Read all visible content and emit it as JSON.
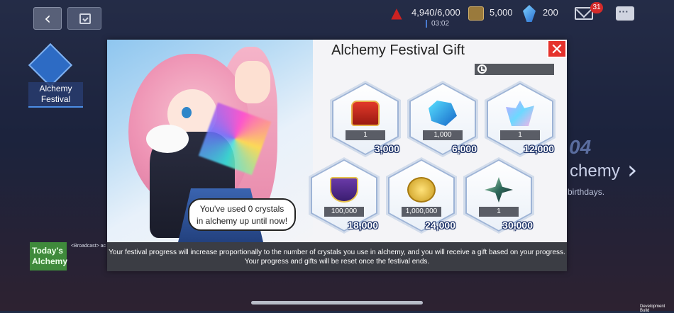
{
  "topbar": {
    "back_icon": "back-arrow-icon",
    "calendar_icon": "calendar-check-icon",
    "stamina": "4,940/6,000",
    "stamina_timer": "03:02",
    "gold": "5,000",
    "crystals": "200",
    "mail_badge": "31"
  },
  "left_panel": {
    "event_label_line1": "Alchemy",
    "event_label_line2": "Festival",
    "today_line1": "Today's",
    "today_line2": "Alchemy",
    "broadcast_text": "<Broadcast> ac"
  },
  "background": {
    "number": "04",
    "alchemy": "chemy",
    "birthdays": "birthdays."
  },
  "popup": {
    "title": "Alchemy Festival Gift",
    "close_icon": "close-x-icon",
    "speech_line1": "You've used 0 crystals",
    "speech_line2": "in alchemy up until now!",
    "rewards": [
      {
        "item": "treasure-chest",
        "quantity": "1",
        "requirement": "3,000"
      },
      {
        "item": "blue-stone",
        "quantity": "1,000",
        "requirement": "6,000"
      },
      {
        "item": "crystal-cluster",
        "quantity": "1",
        "requirement": "12,000"
      },
      {
        "item": "purple-badge",
        "quantity": "100,000",
        "requirement": "18,000"
      },
      {
        "item": "gold-coin",
        "quantity": "1,000,000",
        "requirement": "24,000"
      },
      {
        "item": "star-shard",
        "quantity": "1",
        "requirement": "30,000"
      }
    ],
    "footer_line1": "Your festival progress will increase proportionally to the number of crystals you use in alchemy, and you will receive a gift based on your progress.",
    "footer_line2": "Your progress and gifts will be reset once the festival ends."
  },
  "dev_build": "Development Build",
  "colors": {
    "accent_red": "#e5322c",
    "hex_border": "#9eb4d6",
    "footer_bg": "#3b3d44"
  }
}
